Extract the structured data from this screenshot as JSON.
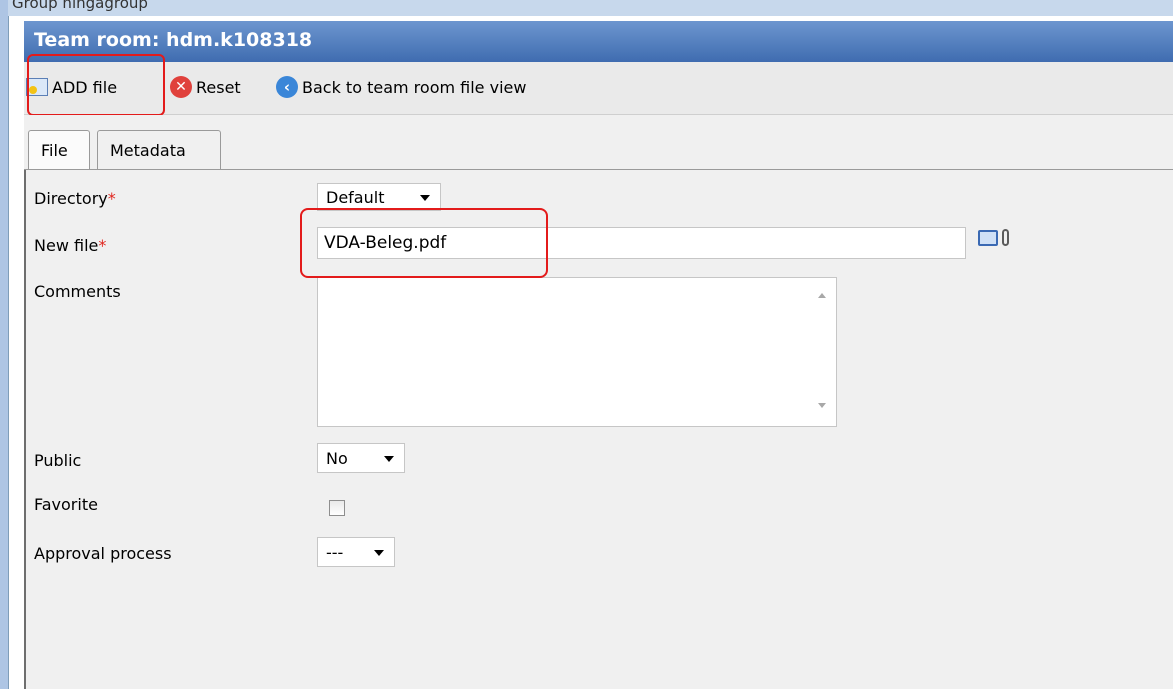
{
  "header": {
    "partial_text": "Group     hingagroup",
    "title": "Team room: hdm.k108318"
  },
  "toolbar": {
    "add_label": "ADD file",
    "reset_label": "Reset",
    "back_label": "Back to team room file view"
  },
  "tabs": [
    {
      "label": "File",
      "selected": true
    },
    {
      "label": "Metadata",
      "selected": false
    }
  ],
  "form": {
    "directory": {
      "label": "Directory",
      "required_mark": "*",
      "value": "Default"
    },
    "new_file": {
      "label": "New file",
      "required_mark": "*",
      "value": "VDA-Beleg.pdf"
    },
    "comments": {
      "label": "Comments",
      "value": ""
    },
    "public": {
      "label": "Public",
      "value": "No"
    },
    "favorite": {
      "label": "Favorite",
      "checked": false
    },
    "approval": {
      "label": "Approval process",
      "value": "---"
    }
  },
  "colors": {
    "title_bar": "#4f7fc1",
    "highlight": "#e31b1b",
    "required": "#e0261f"
  },
  "icons": {
    "add": "add-file-icon",
    "reset": "reset-icon",
    "back": "back-arrow-icon",
    "folder": "folder-open-icon",
    "attach": "paperclip-icon"
  }
}
